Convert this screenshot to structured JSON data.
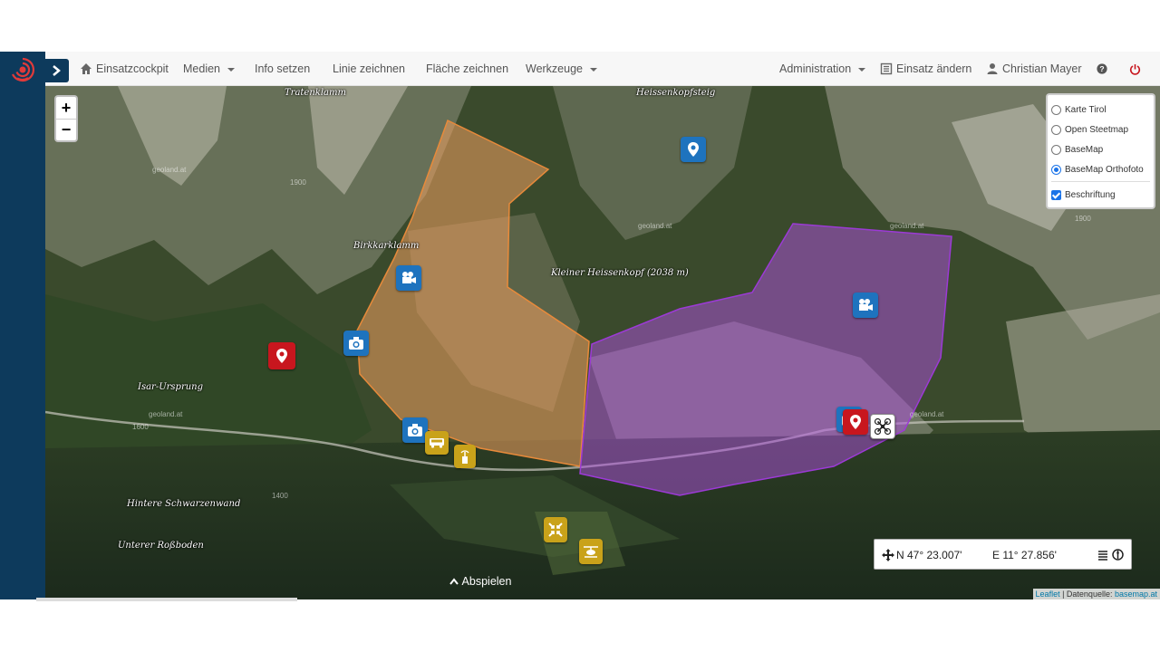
{
  "navbar": {
    "items": [
      {
        "label": "Einsatzcockpit",
        "icon": "home-icon"
      },
      {
        "label": "Medien",
        "dropdown": true
      },
      {
        "label": "Info setzen"
      },
      {
        "label": "Linie zeichnen"
      },
      {
        "label": "Fläche zeichnen"
      },
      {
        "label": "Werkzeuge",
        "dropdown": true
      },
      {
        "label": "Administration",
        "dropdown": true
      },
      {
        "label": "Einsatz ändern",
        "icon": "list-icon"
      },
      {
        "label": "Christian Mayer",
        "icon": "user-icon"
      }
    ],
    "help_icon": "question-circle-icon",
    "power_icon": "power-icon"
  },
  "zoom": {
    "in": "+",
    "out": "−"
  },
  "layers": {
    "base": [
      {
        "label": "Karte Tirol",
        "selected": false
      },
      {
        "label": "Open Steetmap",
        "selected": false
      },
      {
        "label": "BaseMap",
        "selected": false
      },
      {
        "label": "BaseMap Orthofoto",
        "selected": true
      }
    ],
    "overlays": [
      {
        "label": "Beschriftung",
        "checked": true
      }
    ]
  },
  "map_labels": {
    "trat": "Tratenklamm",
    "heissen": "Heissenkopfsteig",
    "birk": "Birkkarklamm",
    "kleiner": "Kleiner Heissenkopf (2038 m)",
    "isar": "Isar-Ursprung",
    "hintere": "Hintere Schwarzenwand",
    "untere": "Unterer Roßboden",
    "geoland": "geoland.at",
    "e1900": "1900",
    "e1600": "1600",
    "e1400": "1400"
  },
  "coords": {
    "n": "N 47° 23.007'",
    "e": "E 11° 27.856'"
  },
  "playback": {
    "label": "Abspielen"
  },
  "attribution": {
    "leaflet": "Leaflet",
    "sep": " | Datenquelle: ",
    "source": "basemap.at"
  },
  "colors": {
    "sidebar": "#0d3a5c",
    "area_orange": "#f0a060",
    "area_purple": "#b050e0",
    "marker_blue": "#1e73be",
    "marker_red": "#c8161e",
    "marker_yellow": "#c9a21a"
  }
}
